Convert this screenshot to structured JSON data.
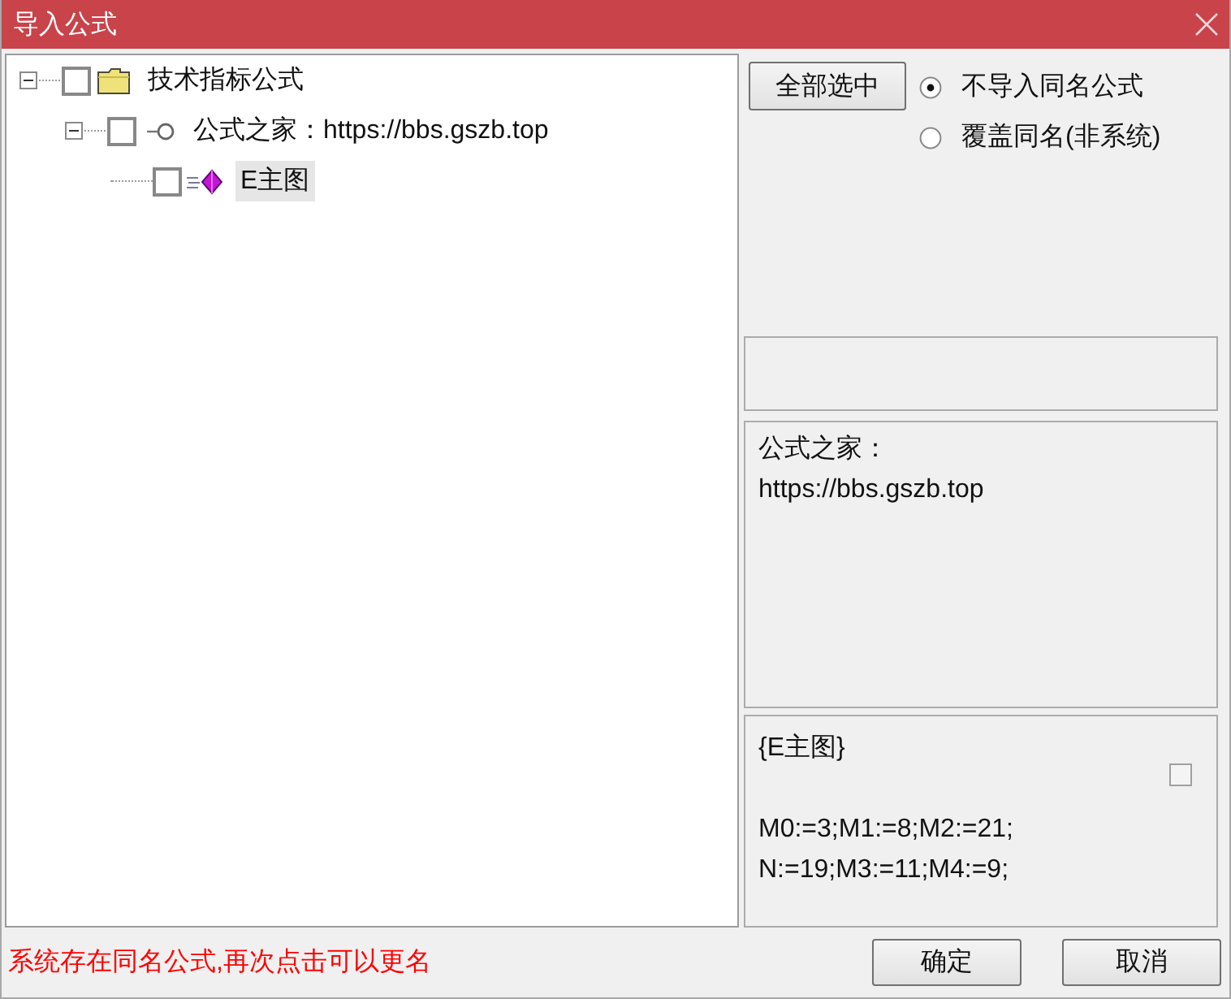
{
  "window": {
    "title": "导入公式"
  },
  "tree": {
    "items": [
      {
        "label": "技术指标公式",
        "kind": "folder",
        "expanded": true,
        "checked": false,
        "selected": false,
        "children": [
          {
            "label": "公式之家：https://bbs.gszb.top",
            "kind": "group",
            "expanded": true,
            "checked": false,
            "selected": false,
            "children": [
              {
                "label": "E主图",
                "kind": "formula",
                "checked": false,
                "selected": true
              }
            ]
          }
        ]
      }
    ]
  },
  "select_all_button": {
    "label": "全部选中"
  },
  "options": [
    {
      "label": "不导入同名公式",
      "selected": true
    },
    {
      "label": "覆盖同名(非系统)",
      "selected": false
    }
  ],
  "description": {
    "lines": [
      "公式之家：",
      "https://bbs.gszb.top"
    ]
  },
  "formula": {
    "title": "{E主图}",
    "lines": [
      "M0:=3;M1:=8;M2:=21;",
      "N:=19;M3:=11;M4:=9;"
    ],
    "checkbox": {
      "checked": false
    }
  },
  "status_bar": {
    "message": "系统存在同名公式,再次点击可以更名"
  },
  "buttons": [
    {
      "label": "确定"
    },
    {
      "label": "取消"
    }
  ]
}
